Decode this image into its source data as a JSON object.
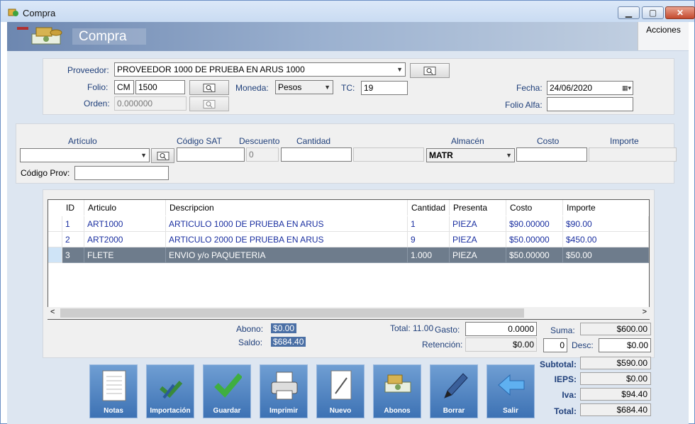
{
  "window": {
    "title": "Compra",
    "minimize": "▁",
    "maximize": "▢",
    "close": "✕"
  },
  "ribbon": {
    "title": "Compra",
    "acciones": "Acciones"
  },
  "header": {
    "proveedor_label": "Proveedor:",
    "proveedor_value": "PROVEEDOR 1000 DE PRUEBA EN ARUS 1000",
    "folio_label": "Folio:",
    "folio_series": "CM",
    "folio_number": "1500",
    "moneda_label": "Moneda:",
    "moneda_value": "Pesos",
    "tc_label": "TC:",
    "tc_value": "19",
    "orden_label": "Orden:",
    "orden_value": "0.000000",
    "fecha_label": "Fecha:",
    "fecha_value": "24/06/2020",
    "folio_alfa_label": "Folio Alfa:",
    "folio_alfa_value": ""
  },
  "entry": {
    "articulo_label": "Artículo",
    "codigo_sat_label": "Código SAT",
    "descuento_label": "Descuento",
    "cantidad_label": "Cantidad",
    "almacen_label": "Almacén",
    "costo_label": "Costo",
    "importe_label": "Importe",
    "articulo_value": "",
    "codigo_sat_value": "",
    "descuento_value": "0",
    "cantidad_value": "",
    "almacen_value": "MATR",
    "costo_value": "",
    "importe_value": "",
    "codigo_prov_label": "Código Prov:",
    "codigo_prov_value": ""
  },
  "grid": {
    "columns": [
      "ID",
      "Articulo",
      "Descripcion",
      "Cantidad",
      "Presenta",
      "Costo",
      "Importe"
    ],
    "rows": [
      {
        "id": "1",
        "articulo": "ART1000",
        "descripcion": "ARTICULO 1000 DE PRUEBA EN ARUS",
        "cantidad": "1",
        "presenta": "PIEZA",
        "costo": "$90.00000",
        "importe": "$90.00"
      },
      {
        "id": "2",
        "articulo": "ART2000",
        "descripcion": "ARTICULO 2000 DE PRUEBA EN ARUS",
        "cantidad": "9",
        "presenta": "PIEZA",
        "costo": "$50.00000",
        "importe": "$450.00"
      },
      {
        "id": "3",
        "articulo": "FLETE",
        "descripcion": "ENVIO y/o PAQUETERIA",
        "cantidad": "1.000",
        "presenta": "PIEZA",
        "costo": "$50.00000",
        "importe": "$50.00"
      }
    ]
  },
  "footer": {
    "abono_label": "Abono:",
    "abono_value": "$0.00",
    "saldo_label": "Saldo:",
    "saldo_value": "$684.40",
    "total_items": "Total: 11.00",
    "gasto_label": "Gasto:",
    "gasto_value": "0.0000",
    "retencion_label": "Retención:",
    "retencion_value": "$0.00",
    "suma_label": "Suma:",
    "suma_value": "$600.00",
    "desc_pct": "0",
    "desc_label": "Desc:",
    "desc_value": "$0.00"
  },
  "totals": {
    "subtotal_label": "Subtotal:",
    "subtotal_value": "$590.00",
    "ieps_label": "IEPS:",
    "ieps_value": "$0.00",
    "iva_label": "Iva:",
    "iva_value": "$94.40",
    "total_label": "Total:",
    "total_value": "$684.40"
  },
  "toolbar": {
    "notas": "Notas",
    "importacion": "Importación",
    "guardar": "Guardar",
    "imprimir": "Imprimir",
    "nuevo": "Nuevo",
    "abonos": "Abonos",
    "borrar": "Borrar",
    "salir": "Salir"
  }
}
